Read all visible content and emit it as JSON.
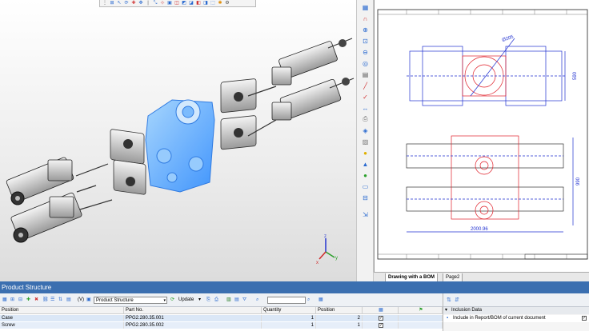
{
  "viewport": {
    "axis_labels": [
      "z",
      "y",
      "x"
    ]
  },
  "drawing": {
    "dim_diameter": "Ø205",
    "dim_width": "2000.96",
    "dim_height_top": "590",
    "dim_height_bottom": "990",
    "tabs": [
      "Drawing with a BOM",
      "Page2"
    ]
  },
  "product_structure": {
    "title": "Product Structure",
    "toolbar": {
      "filter_label": "(V)",
      "structure_select": "Product Structure",
      "update_label": "Update",
      "search_placeholder": ""
    },
    "columns": [
      "Position",
      "Part No.",
      "Quantity",
      "Position"
    ],
    "rows": [
      {
        "name": "Case",
        "part_no": "PPG2.280.35.001",
        "quantity": "1",
        "position": "2",
        "checked": true
      },
      {
        "name": "Screw",
        "part_no": "PPG2.280.35.002",
        "quantity": "1",
        "position": "1",
        "checked": true
      }
    ]
  },
  "properties": {
    "group": "Inclusion Data",
    "item": "Include in Report/BOM of current document",
    "checked": true
  },
  "colors": {
    "accent": "#3b6fb0",
    "selection": "#4aa3ff",
    "drawing_blue": "#1f2fd0",
    "drawing_red": "#e0202a"
  }
}
